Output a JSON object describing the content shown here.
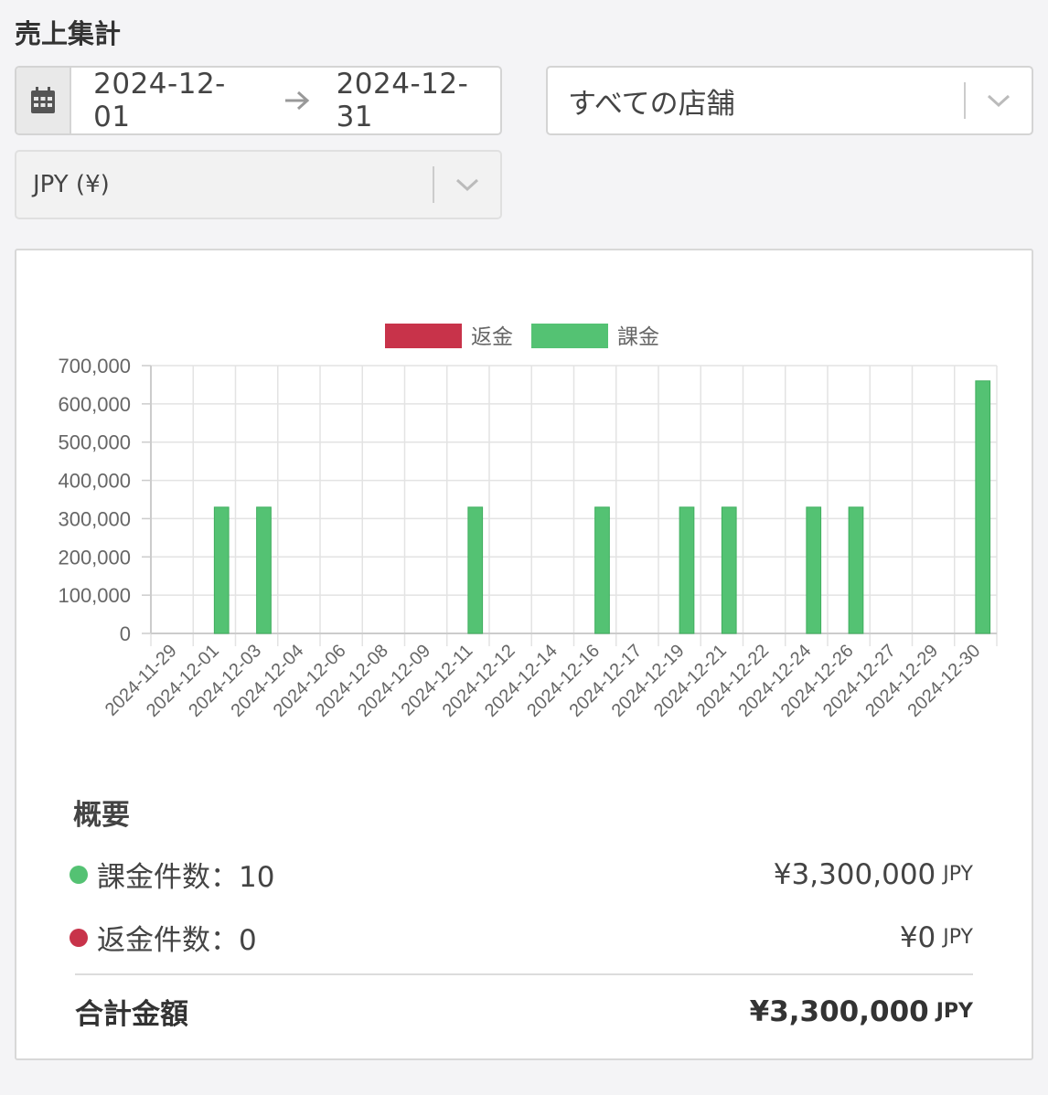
{
  "page_title": "売上集計",
  "date_range": {
    "start": "2024-12-01",
    "end": "2024-12-31"
  },
  "store_select": {
    "value": "すべての店舗"
  },
  "currency_select": {
    "value": "JPY (¥)"
  },
  "colors": {
    "refund": "#c8334a",
    "charge": "#54c273"
  },
  "chart_data": {
    "type": "bar",
    "legend_position": "top",
    "grid": true,
    "ylim": [
      0,
      700000
    ],
    "yticks": [
      "700,000",
      "600,000",
      "500,000",
      "400,000",
      "300,000",
      "200,000",
      "100,000",
      "0"
    ],
    "categories": [
      "2024-11-29",
      "2024-12-01",
      "2024-12-03",
      "2024-12-04",
      "2024-12-06",
      "2024-12-08",
      "2024-12-09",
      "2024-12-11",
      "2024-12-12",
      "2024-12-14",
      "2024-12-16",
      "2024-12-17",
      "2024-12-19",
      "2024-12-21",
      "2024-12-22",
      "2024-12-24",
      "2024-12-26",
      "2024-12-27",
      "2024-12-29",
      "2024-12-30"
    ],
    "series": [
      {
        "name": "返金",
        "color": "#c8334a",
        "values": [
          0,
          0,
          0,
          0,
          0,
          0,
          0,
          0,
          0,
          0,
          0,
          0,
          0,
          0,
          0,
          0,
          0,
          0,
          0,
          0
        ]
      },
      {
        "name": "課金",
        "color": "#54c273",
        "values": [
          0,
          330000,
          330000,
          0,
          0,
          0,
          0,
          330000,
          0,
          0,
          330000,
          0,
          330000,
          330000,
          0,
          330000,
          330000,
          0,
          0,
          660000
        ]
      }
    ]
  },
  "summary": {
    "title": "概要",
    "charge_label": "課金件数：10",
    "charge_amount": "¥3,300,000",
    "refund_label": "返金件数：0",
    "refund_amount": "¥0",
    "currency": "JPY",
    "total_label": "合計金額",
    "total_amount": "¥3,300,000"
  }
}
